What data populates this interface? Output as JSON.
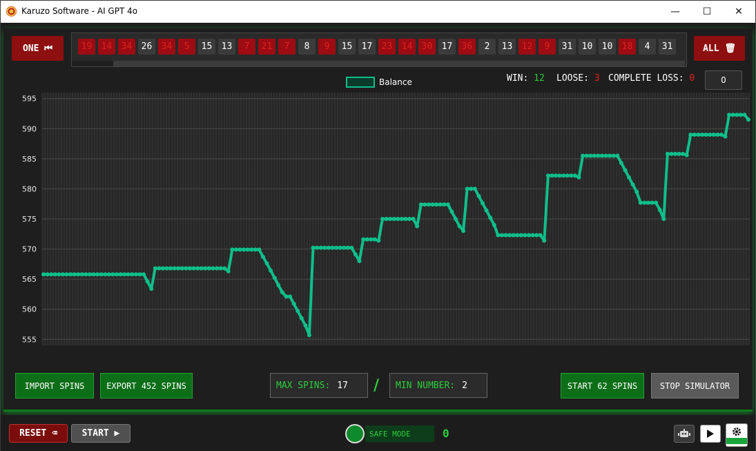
{
  "window": {
    "title": "Karuzo Software - AI GPT 4o",
    "minimize": "—",
    "maximize": "☐",
    "close": "✕"
  },
  "toolbar": {
    "one_label": "ONE ⏮",
    "all_label": "ALL 🗑"
  },
  "spins": [
    {
      "n": "19",
      "c": "red"
    },
    {
      "n": "14",
      "c": "red"
    },
    {
      "n": "34",
      "c": "red"
    },
    {
      "n": "26",
      "c": "black"
    },
    {
      "n": "34",
      "c": "red"
    },
    {
      "n": "5",
      "c": "red"
    },
    {
      "n": "15",
      "c": "black"
    },
    {
      "n": "13",
      "c": "black"
    },
    {
      "n": "7",
      "c": "red"
    },
    {
      "n": "21",
      "c": "red"
    },
    {
      "n": "7",
      "c": "red"
    },
    {
      "n": "8",
      "c": "black"
    },
    {
      "n": "9",
      "c": "red"
    },
    {
      "n": "15",
      "c": "black"
    },
    {
      "n": "17",
      "c": "black"
    },
    {
      "n": "23",
      "c": "red"
    },
    {
      "n": "14",
      "c": "red"
    },
    {
      "n": "30",
      "c": "red"
    },
    {
      "n": "17",
      "c": "black"
    },
    {
      "n": "36",
      "c": "red"
    },
    {
      "n": "2",
      "c": "black"
    },
    {
      "n": "13",
      "c": "black"
    },
    {
      "n": "12",
      "c": "red"
    },
    {
      "n": "9",
      "c": "red"
    },
    {
      "n": "31",
      "c": "black"
    },
    {
      "n": "10",
      "c": "black"
    },
    {
      "n": "10",
      "c": "black"
    },
    {
      "n": "18",
      "c": "red"
    },
    {
      "n": "4",
      "c": "black"
    },
    {
      "n": "31",
      "c": "black"
    }
  ],
  "stats": {
    "win_label": "WIN:",
    "win_value": "12",
    "loose_label": "LOOSE:",
    "loose_value": "3",
    "complete_loss_label": "COMPLETE LOSS:",
    "complete_loss_value": "0",
    "counter_value": "0"
  },
  "colors": {
    "accent_green": "#2ccd3c",
    "balance_line": "#0fbf8a",
    "red": "#9c0c12"
  },
  "chart_data": {
    "type": "line",
    "legend": [
      "Balance"
    ],
    "ylim": [
      554,
      596
    ],
    "yticks": [
      555,
      560,
      565,
      570,
      575,
      580,
      585,
      590,
      595
    ],
    "grid": true,
    "series": [
      {
        "name": "Balance",
        "values": [
          565.8,
          565.8,
          565.8,
          565.8,
          565.8,
          565.8,
          565.8,
          565.8,
          565.8,
          565.8,
          565.8,
          565.8,
          565.8,
          565.8,
          565.8,
          565.8,
          565.8,
          565.8,
          565.8,
          565.8,
          565.8,
          565.8,
          565.8,
          565.8,
          565.8,
          565.8,
          565.8,
          564.6,
          563.4,
          566.8,
          566.8,
          566.8,
          566.8,
          566.8,
          566.8,
          566.8,
          566.8,
          566.8,
          566.8,
          566.8,
          566.8,
          566.8,
          566.8,
          566.8,
          566.8,
          566.8,
          566.8,
          566.8,
          566.3,
          569.9,
          569.9,
          569.9,
          569.9,
          569.9,
          569.9,
          569.9,
          569.9,
          568.7,
          567.6,
          566.4,
          565.2,
          564.0,
          562.8,
          562.1,
          562.1,
          560.9,
          559.7,
          558.5,
          557.3,
          555.7,
          570.2,
          570.2,
          570.2,
          570.2,
          570.2,
          570.2,
          570.2,
          570.2,
          570.2,
          570.2,
          570.2,
          569.1,
          568.0,
          571.6,
          571.6,
          571.6,
          571.6,
          571.4,
          575.0,
          575.0,
          575.0,
          575.0,
          575.0,
          575.0,
          575.0,
          575.0,
          575.0,
          573.8,
          577.4,
          577.4,
          577.4,
          577.4,
          577.4,
          577.4,
          577.4,
          577.4,
          576.2,
          575.0,
          573.8,
          573.0,
          580.0,
          580.0,
          580.0,
          578.8,
          577.6,
          576.4,
          575.2,
          574.0,
          572.3,
          572.3,
          572.3,
          572.3,
          572.3,
          572.3,
          572.3,
          572.3,
          572.3,
          572.3,
          572.3,
          572.3,
          571.4,
          582.2,
          582.2,
          582.2,
          582.2,
          582.2,
          582.2,
          582.2,
          582.2,
          581.9,
          585.5,
          585.5,
          585.5,
          585.5,
          585.5,
          585.5,
          585.5,
          585.5,
          585.5,
          585.5,
          584.3,
          583.1,
          581.9,
          580.7,
          579.5,
          577.7,
          577.7,
          577.7,
          577.7,
          577.7,
          576.5,
          575.0,
          585.8,
          585.8,
          585.8,
          585.8,
          585.8,
          585.6,
          589.0,
          589.0,
          589.0,
          589.0,
          589.0,
          589.0,
          589.0,
          589.0,
          589.0,
          588.7,
          592.3,
          592.3,
          592.3,
          592.3,
          592.3,
          591.5
        ]
      }
    ]
  },
  "controls": {
    "import_label": "IMPORT SPINS",
    "export_label": "EXPORT 452 SPINS",
    "max_spins_label": "MAX SPINS:",
    "max_spins_value": "17",
    "slash": "/",
    "min_number_label": "MIN NUMBER:",
    "min_number_value": "2",
    "start_spins_label": "START 62 SPINS",
    "stop_label": "STOP SIMULATOR"
  },
  "bottom": {
    "reset_label": "RESET ⌫",
    "start_label": "START ▶",
    "safe_mode_label": "SAFE MODE",
    "safe_mode_count": "0",
    "robot_icon": "robot-icon",
    "play_icon": "play-icon",
    "settings_icon": "gear-icon"
  }
}
